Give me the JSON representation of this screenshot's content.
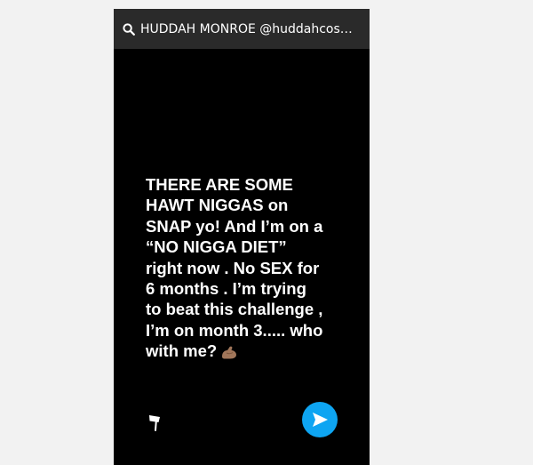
{
  "search": {
    "text": "HUDDAH MONROE @huddahcosm..."
  },
  "story": {
    "text": "THERE ARE SOME\nHAWT NIGGAS on\nSNAP yo! And I’m on a\n“NO NIGGA DIET”\nright now . No SEX for\n6 months . I’m trying\nto beat this challenge ,\nI’m on month 3..... who\nwith me?",
    "emoji": "flexed-biceps-emoji"
  },
  "icons": {
    "search": "search-icon",
    "flag": "flag-icon",
    "send": "send-arrow-icon"
  },
  "colors": {
    "background": "#f2f2f2",
    "story_background": "#000000",
    "search_bar": "#2a2a2a",
    "send_button": "#0ea5f2"
  }
}
